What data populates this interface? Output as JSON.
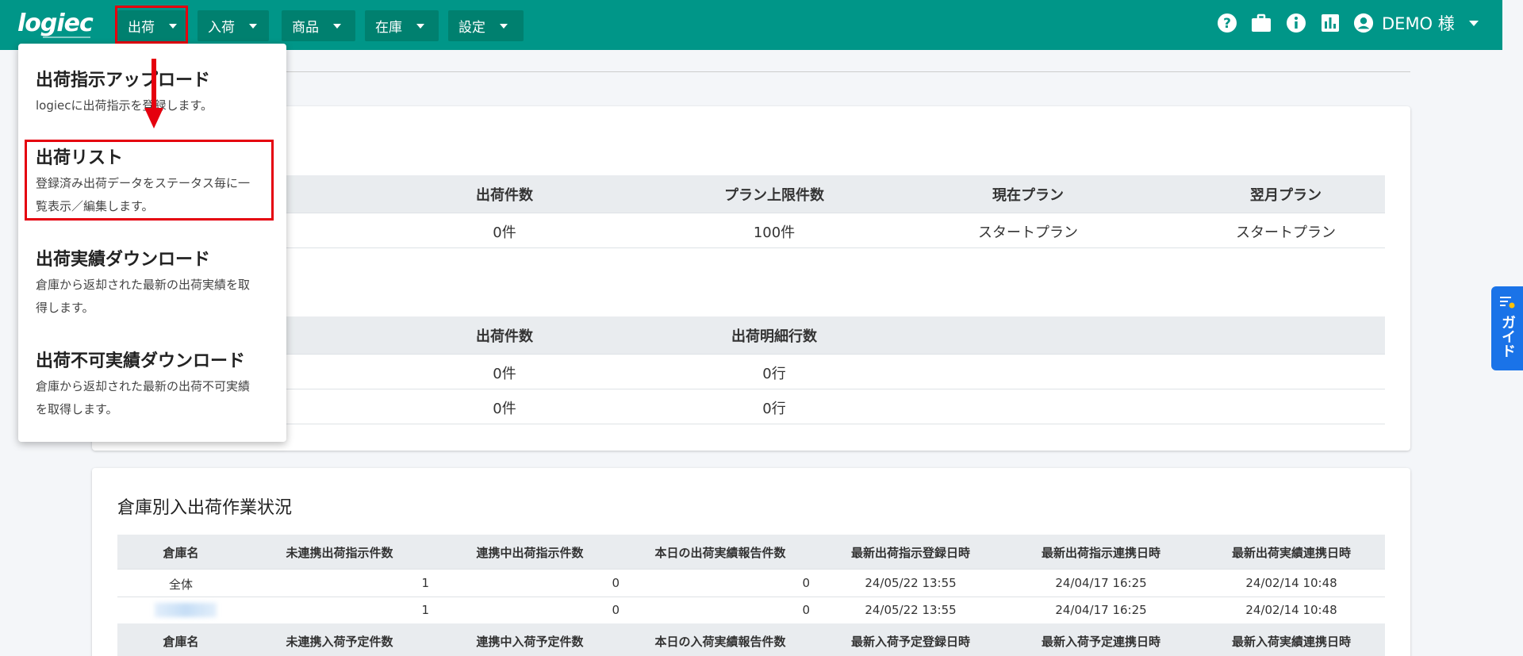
{
  "header": {
    "logo": "logiec",
    "nav": [
      {
        "label": "出荷"
      },
      {
        "label": "入荷"
      },
      {
        "label": "商品"
      },
      {
        "label": "在庫"
      },
      {
        "label": "設定"
      }
    ],
    "user": "DEMO 様",
    "icons": [
      "help-icon",
      "briefcase-icon",
      "info-icon",
      "chart-icon",
      "account-icon"
    ]
  },
  "dropdown": {
    "items": [
      {
        "title": "出荷指示アップロード",
        "desc": "logiecに出荷指示を登録します。"
      },
      {
        "title": "出荷リスト",
        "desc": "登録済み出荷データをステータス毎に一覧表示／編集します。",
        "desc1": "登録済み出荷データをステータス毎に一",
        "desc2": "覧表示／編集します。"
      },
      {
        "title": "出荷実績ダウンロード",
        "desc1": "倉庫から返却された最新の出荷実績を取",
        "desc2": "得します。"
      },
      {
        "title": "出荷不可実績ダウンロード",
        "desc1": "倉庫から返却された最新の出荷不可実績",
        "desc2": "を取得します。"
      }
    ]
  },
  "plan_table": {
    "headers": [
      "出荷件数",
      "プラン上限件数",
      "現在プラン",
      "翌月プラン"
    ],
    "row": [
      "0件",
      "100件",
      "スタートプラン",
      "スタートプラン"
    ]
  },
  "count_table": {
    "headers": [
      "出荷件数",
      "出荷明細行数"
    ],
    "rows": [
      [
        "0件",
        "0行"
      ],
      [
        "0件",
        "0行"
      ]
    ]
  },
  "warehouse": {
    "title": "倉庫別入出荷作業状況",
    "ship_headers": [
      "倉庫名",
      "未連携出荷指示件数",
      "連携中出荷指示件数",
      "本日の出荷実績報告件数",
      "最新出荷指示登録日時",
      "最新出荷指示連携日時",
      "最新出荷実績連携日時"
    ],
    "ship_rows": [
      [
        "全体",
        "1",
        "0",
        "0",
        "24/05/22 13:55",
        "24/04/17 16:25",
        "24/02/14 10:48"
      ],
      [
        "",
        "1",
        "0",
        "0",
        "24/05/22 13:55",
        "24/04/17 16:25",
        "24/02/14 10:48"
      ]
    ],
    "recv_headers": [
      "倉庫名",
      "未連携入荷予定件数",
      "連携中入荷予定件数",
      "本日の入荷実績報告件数",
      "最新入荷予定登録日時",
      "最新入荷予定連携日時",
      "最新入荷実績連携日時"
    ]
  },
  "guide": {
    "label": "ガイド"
  },
  "colors": {
    "header": "#009688",
    "nav_button": "#00806f",
    "highlight": "#e5000e",
    "guide": "#1a73e8"
  }
}
